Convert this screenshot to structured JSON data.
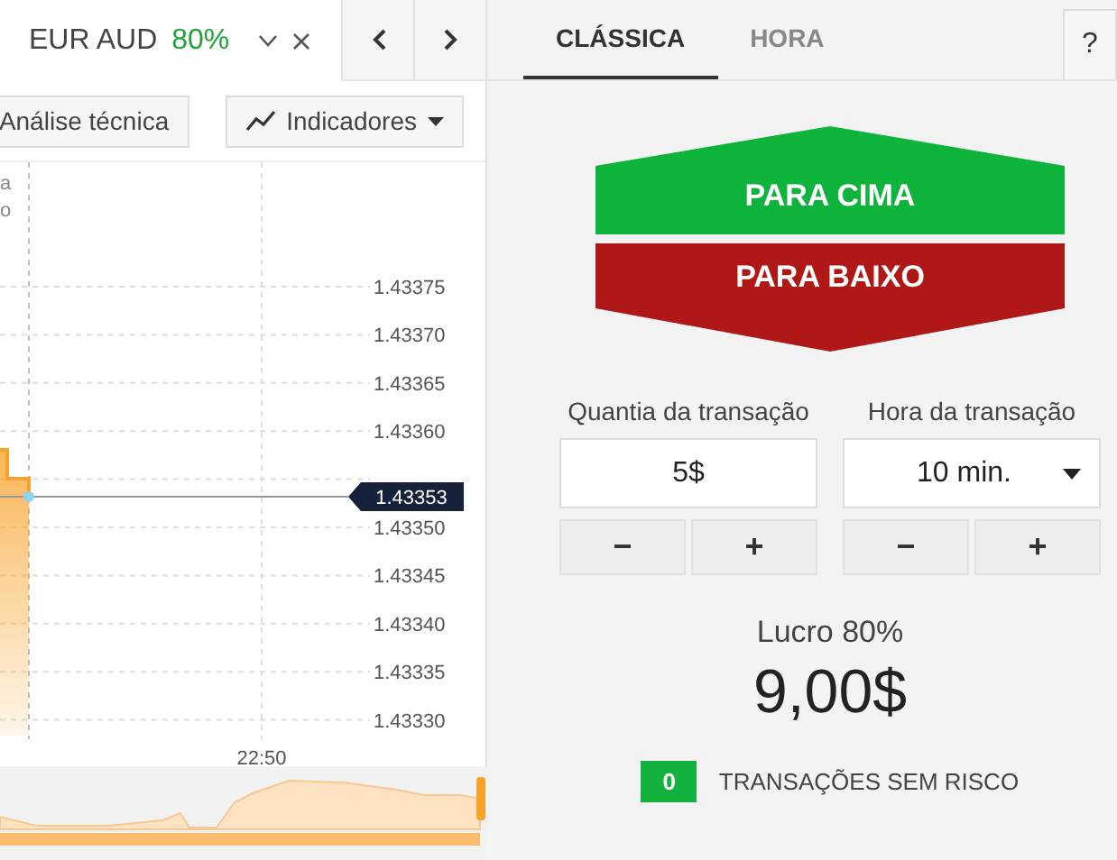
{
  "instrument_tab": {
    "pair": "EUR AUD",
    "payout": "80%"
  },
  "toolbar": {
    "buttons": [
      {
        "label": "Análise técnica",
        "kind": "plain"
      },
      {
        "label": "Indicadores",
        "kind": "dropdown"
      }
    ]
  },
  "chart": {
    "cut_label": [
      "a",
      "o"
    ],
    "current_price": "1.43353",
    "time_label": "22:50",
    "price_labels": [
      "1.43375",
      "1.43370",
      "1.43365",
      "1.43360",
      "1.43350",
      "1.43345",
      "1.43340",
      "1.43335",
      "1.43330"
    ]
  },
  "mode_tabs": [
    {
      "label": "CLÁSSICA",
      "selected": true
    },
    {
      "label": "HORA",
      "selected": false
    }
  ],
  "help_button": "?",
  "trade_buttons": [
    {
      "label": "PARA CIMA",
      "kind": "up"
    },
    {
      "label": "PARA BAIXO",
      "kind": "down"
    }
  ],
  "amount": {
    "label": "Quantia da transação",
    "value": "5$",
    "steppers": [
      "−",
      "+"
    ]
  },
  "time": {
    "label": "Hora da transação",
    "value": "10 min.",
    "steppers": [
      "−",
      "+"
    ]
  },
  "profit": {
    "label": "Lucro 80%",
    "value": "9,00$"
  },
  "risk_free": {
    "count": "0",
    "label": "TRANSAÇÕES SEM RISCO"
  }
}
